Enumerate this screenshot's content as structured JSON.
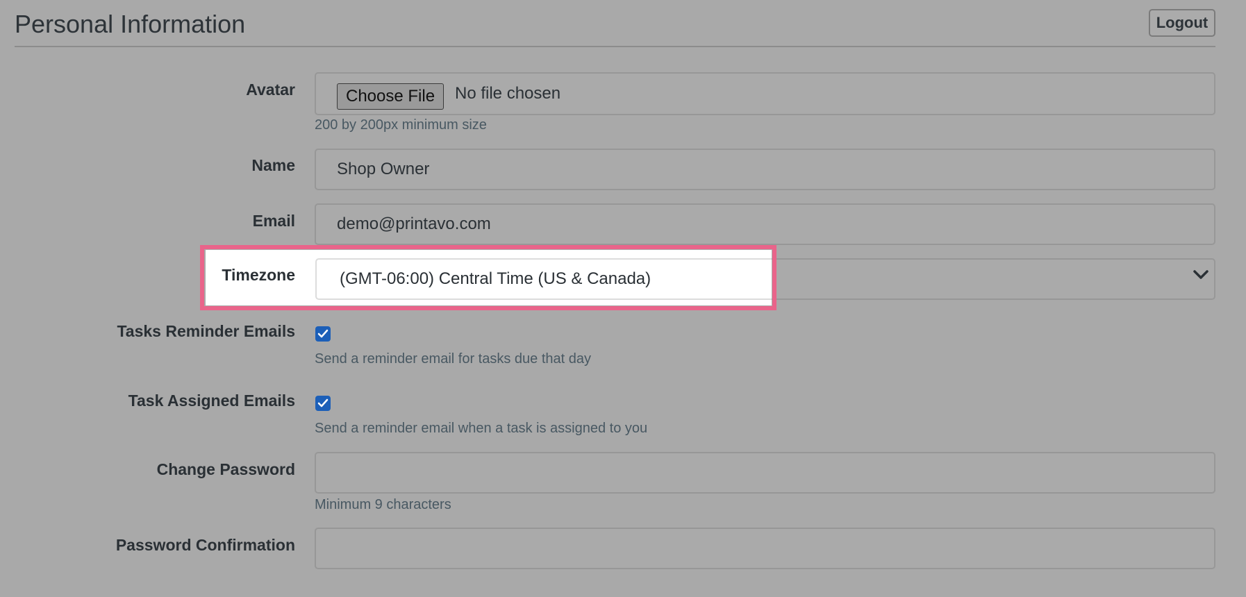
{
  "header": {
    "title": "Personal Information",
    "logout_label": "Logout"
  },
  "form": {
    "avatar": {
      "label": "Avatar",
      "choose_label": "Choose File",
      "status": "No file chosen",
      "help": "200 by 200px minimum size"
    },
    "name": {
      "label": "Name",
      "value": "Shop Owner"
    },
    "email": {
      "label": "Email",
      "value": "demo@printavo.com"
    },
    "timezone": {
      "label": "Timezone",
      "value": "(GMT-06:00) Central Time (US & Canada)"
    },
    "tasks_reminder": {
      "label": "Tasks Reminder Emails",
      "checked": true,
      "help": "Send a reminder email for tasks due that day"
    },
    "task_assigned": {
      "label": "Task Assigned Emails",
      "checked": true,
      "help": "Send a reminder email when a task is assigned to you"
    },
    "change_password": {
      "label": "Change Password",
      "value": "",
      "help": "Minimum 9 characters"
    },
    "password_confirmation": {
      "label": "Password Confirmation",
      "value": ""
    }
  },
  "colors": {
    "overlay_bg": "#a9a9a9",
    "highlight": "#e9648a",
    "checkbox": "#1c5fb8"
  }
}
